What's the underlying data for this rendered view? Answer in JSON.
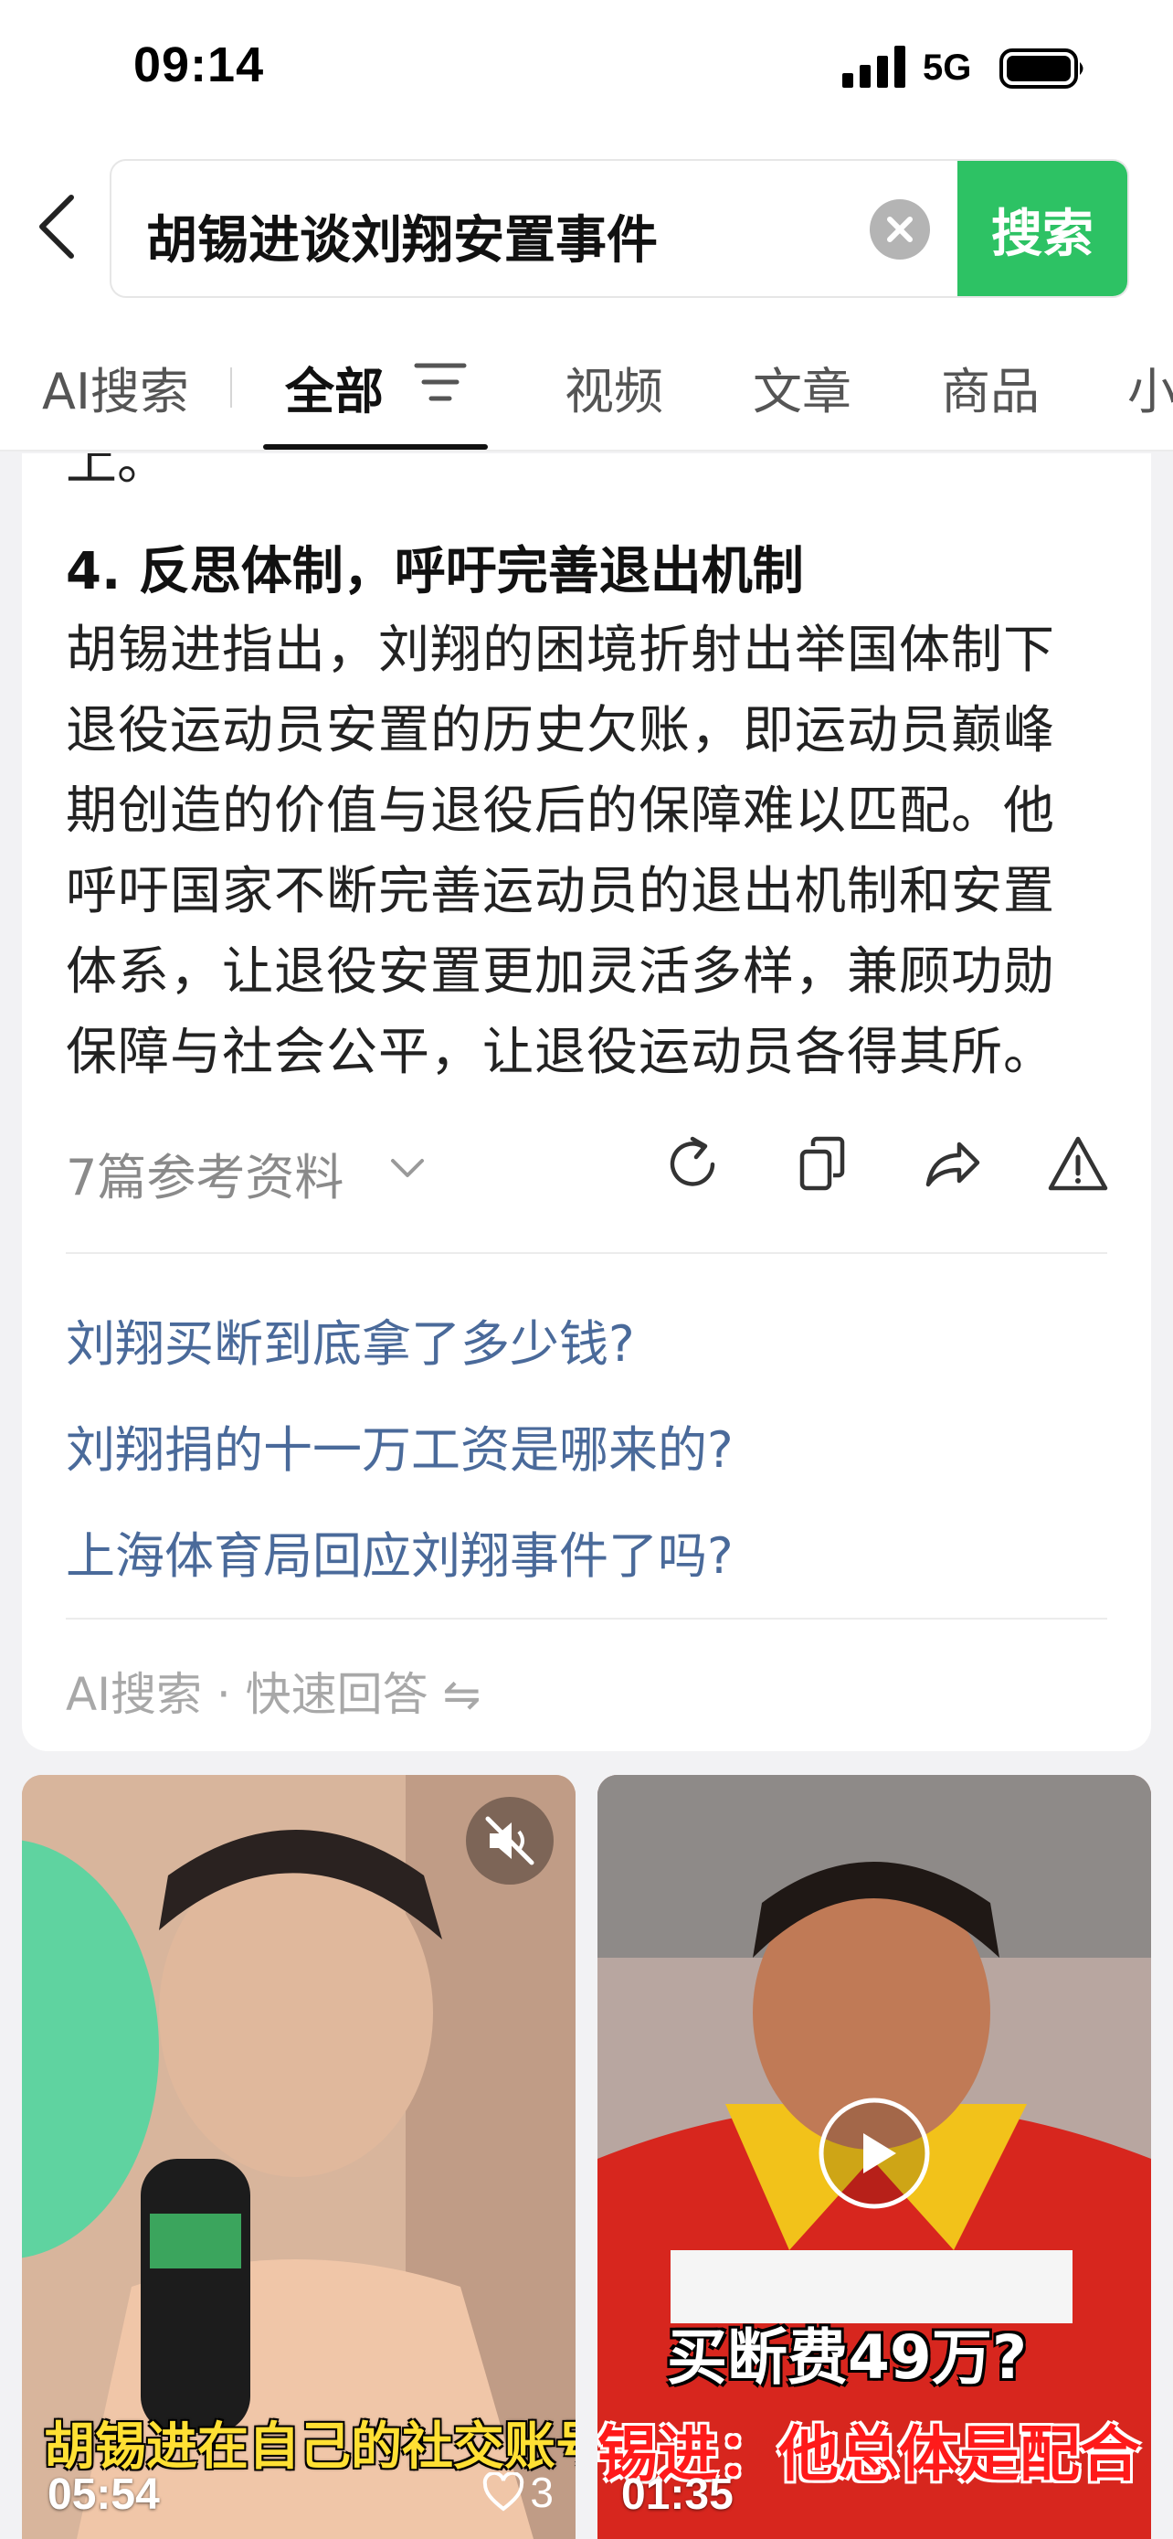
{
  "status_bar": {
    "time": "09:14",
    "network": "5G"
  },
  "search": {
    "query": "胡锡进谈刘翔安置事件",
    "button_label": "搜索"
  },
  "tabs": [
    {
      "label": "AI搜索",
      "active": false
    },
    {
      "label": "全部",
      "active": true
    },
    {
      "label": "视频",
      "active": false
    },
    {
      "label": "文章",
      "active": false
    },
    {
      "label": "商品",
      "active": false
    },
    {
      "label": "小",
      "active": false
    }
  ],
  "answer": {
    "cut_text": "上。",
    "section_title": "4. 反思体制，呼吁完善退出机制",
    "body_lines": [
      "胡锡进指出，刘翔的困境折射出举国体制下",
      "退役运动员安置的历史欠账，即运动员巅峰",
      "期创造的价值与退役后的保障难以匹配。他",
      "呼吁国家不断完善运动员的退出机制和安置",
      "体系，让退役安置更加灵活多样，兼顾功勋",
      "保障与社会公平，让退役运动员各得其所。"
    ],
    "references_label": "7篇参考资料",
    "actions": [
      "refresh-icon",
      "copy-icon",
      "share-icon",
      "report-icon"
    ]
  },
  "related_questions": [
    "刘翔买断到底拿了多少钱?",
    "刘翔捐的十一万工资是哪来的?",
    "上海体育局回应刘翔事件了吗?"
  ],
  "ai_footer": "AI搜索 · 快速回答 ⇋",
  "videos": [
    {
      "caption": "胡锡进在自己的社交账号",
      "duration": "05:54",
      "likes": "3",
      "muted": true
    },
    {
      "caption_line1": "买断费49万?",
      "caption_line2": "锡进：他总体是配合",
      "duration": "01:35",
      "playing": false
    }
  ],
  "colors": {
    "accent_green": "#2dc264",
    "link_blue": "#4a6a9a"
  }
}
